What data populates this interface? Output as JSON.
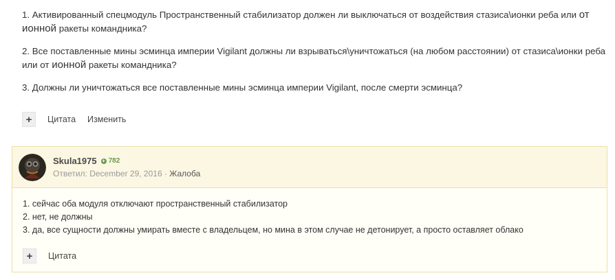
{
  "post": {
    "paragraphs": [
      {
        "a": "1. Активированный спецмодуль Пространственный стабилизатор должен ли выключаться от воздействия стазиса\\ионки реба или ",
        "b": "от ионной",
        "c": " ракеты командника?"
      },
      {
        "a": "2. Все поставленные мины эсминца империи Vigilant должны ли взрываться\\уничтожаться (на любом расстоянии) от стазиса\\ионки реба или от ",
        "b": "ионной",
        "c": " ракеты командника?"
      },
      {
        "a": "3. Должны ли уничтожаться все поставленные мины эсминца империи Vigilant, после смерти эсминца?"
      }
    ],
    "actions": {
      "plus_icon": "+",
      "quote": "Цитата",
      "edit": "Изменить"
    }
  },
  "reply": {
    "author": "Skula1975",
    "reputation": "782",
    "meta_prefix": "Ответил: December 29, 2016 · ",
    "report": "Жалоба",
    "lines": [
      "1. сейчас оба модуля отключают пространственный стабилизатор",
      "2. нет, не должны",
      "3. да, все сущности должны умирать вместе с владельцем, но мина в этом случае не детонирует, а просто оставляет облако"
    ],
    "actions": {
      "plus_icon": "+",
      "quote": "Цитата"
    }
  },
  "colors": {
    "card_bg": "#fffef7",
    "card_border": "#eadfa8",
    "header_bg": "#fbf7e3",
    "reputation": "#6a9a4a"
  }
}
